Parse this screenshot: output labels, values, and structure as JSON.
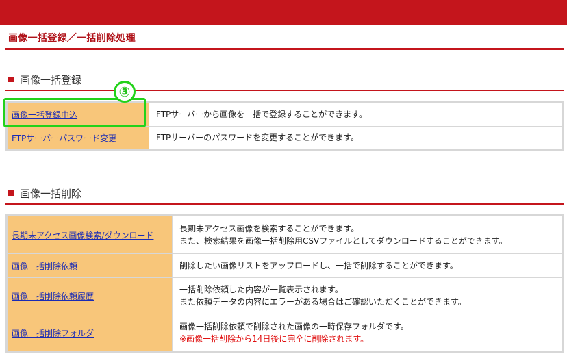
{
  "page_title": "画像一括登録／一括削除処理",
  "colors": {
    "brand_red": "#c4151c",
    "cell_orange": "#f8c67a",
    "link_blue": "#1a2bb5",
    "callout_green": "#22d21a",
    "note_red": "#e01010"
  },
  "callout_number": "③",
  "sections": [
    {
      "title": "画像一括登録",
      "rows": [
        {
          "link": "画像一括登録申込",
          "desc": [
            "FTPサーバーから画像を一括で登録することができます。"
          ]
        },
        {
          "link": "FTPサーバーパスワード変更",
          "desc": [
            "FTPサーバーのパスワードを変更することができます。"
          ]
        }
      ]
    },
    {
      "title": "画像一括削除",
      "rows": [
        {
          "link": "長期未アクセス画像検索/ダウンロード",
          "desc": [
            "長期未アクセス画像を検索することができます。",
            "また、検索結果を画像一括削除用CSVファイルとしてダウンロードすることができます。"
          ]
        },
        {
          "link": "画像一括削除依頼",
          "desc": [
            "削除したい画像リストをアップロードし、一括で削除することができます。"
          ]
        },
        {
          "link": "画像一括削除依頼履歴",
          "desc": [
            "一括削除依頼した内容が一覧表示されます。",
            "また依頼データの内容にエラーがある場合はご確認いただくことができます。"
          ]
        },
        {
          "link": "画像一括削除フォルダ",
          "desc": [
            "画像一括削除依頼で削除された画像の一時保存フォルダです。"
          ],
          "note": "※画像一括削除から14日後に完全に削除されます。"
        }
      ]
    }
  ]
}
